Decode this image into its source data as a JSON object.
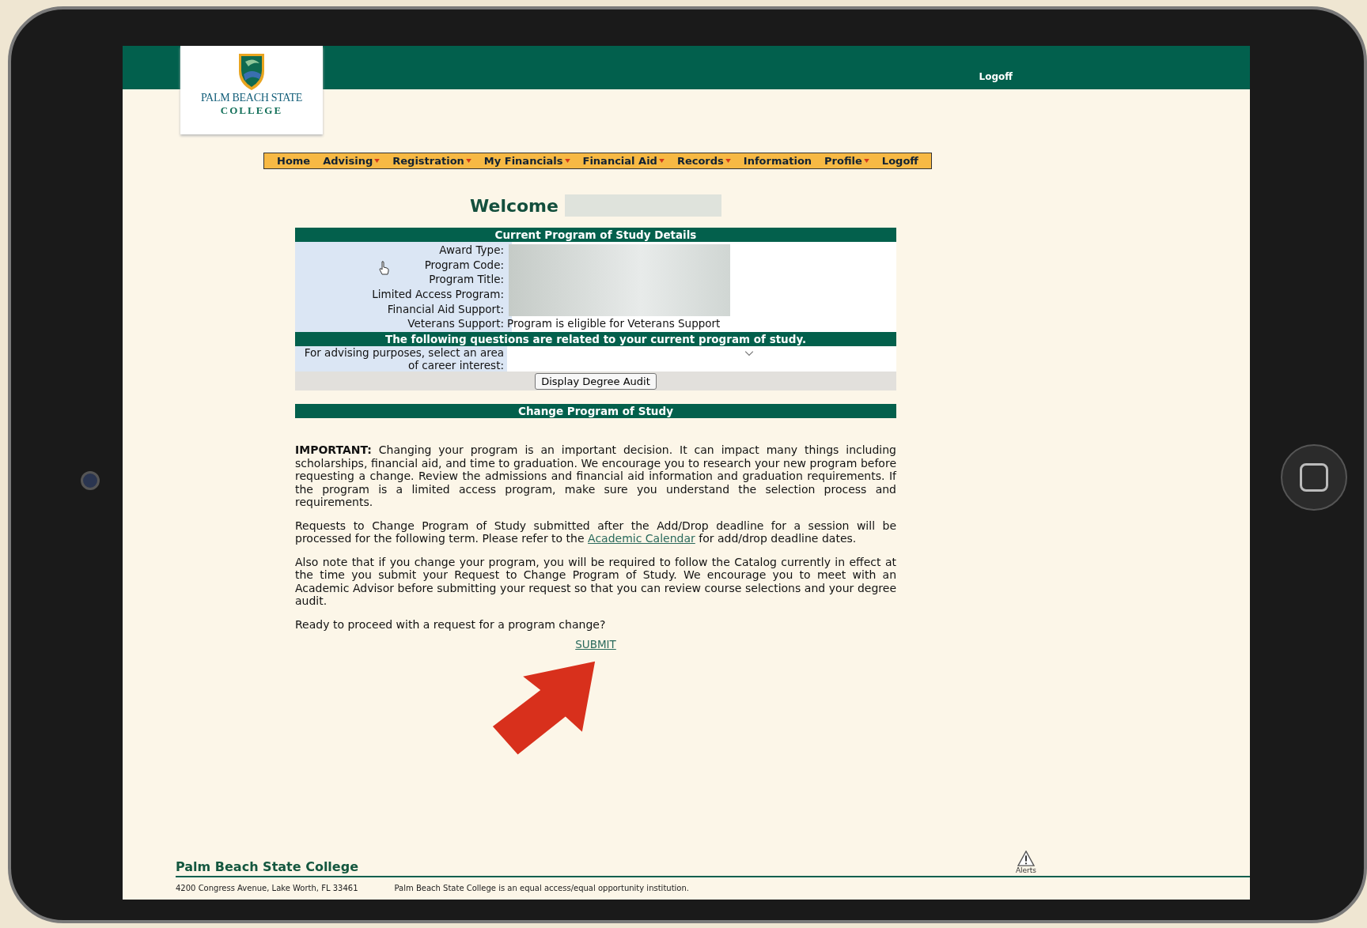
{
  "header": {
    "logo_line1": "PALM BEACH STATE",
    "logo_line2": "COLLEGE",
    "logoff": "Logoff"
  },
  "nav": [
    {
      "label": "Home",
      "dropdown": false
    },
    {
      "label": "Advising",
      "dropdown": true
    },
    {
      "label": "Registration",
      "dropdown": true
    },
    {
      "label": "My Financials",
      "dropdown": true
    },
    {
      "label": "Financial Aid",
      "dropdown": true
    },
    {
      "label": "Records",
      "dropdown": true
    },
    {
      "label": "Information",
      "dropdown": false
    },
    {
      "label": "Profile",
      "dropdown": true
    },
    {
      "label": "Logoff",
      "dropdown": false
    }
  ],
  "welcome": "Welcome",
  "program_details": {
    "title": "Current Program of Study Details",
    "rows": [
      {
        "label": "Award Type:"
      },
      {
        "label": "Program Code:"
      },
      {
        "label": "Program Title:"
      },
      {
        "label": "Limited Access Program:"
      },
      {
        "label": "Financial Aid Support:"
      },
      {
        "label": "Veterans Support:",
        "value": "Program is eligible for Veterans Support"
      }
    ]
  },
  "questions": {
    "title": "The following questions are related to your current program of study.",
    "prompt": "For advising purposes, select an area of career interest:",
    "button": "Display Degree Audit"
  },
  "change": {
    "title": "Change Program of Study",
    "important": "**IMPORTANT:** Changing your program is an important decision. It can impact many things including scholarships, financial aid, and time to graduation. We encourage you to research your new program before requesting a change. Review the admissions and financial aid information and graduation requirements. If the program is a limited access program, make sure you understand the selection process and requirements.",
    "deadline_before": "Requests to Change Program of Study submitted after the Add/Drop deadline for a session will be processed for the following term. Please refer to the",
    "deadline_link": "Academic Calendar",
    "deadline_after": "for add/drop deadline dates.",
    "catalog": "Also note that if you change your program, you will be required to follow the Catalog currently in effect at the time you submit your Request to Change Program of Study. We encourage you to meet with an Academic Advisor before submitting your request so that you can review course selections and your degree audit.",
    "ready": "Ready to proceed with a request for a program change?",
    "submit": "SUBMIT"
  },
  "footer": {
    "college": "Palm Beach State College",
    "alerts": "Alerts",
    "address": "4200 Congress Avenue, Lake Worth, FL 33461",
    "notice": "Palm Beach State College is an equal access/equal opportunity institution."
  }
}
